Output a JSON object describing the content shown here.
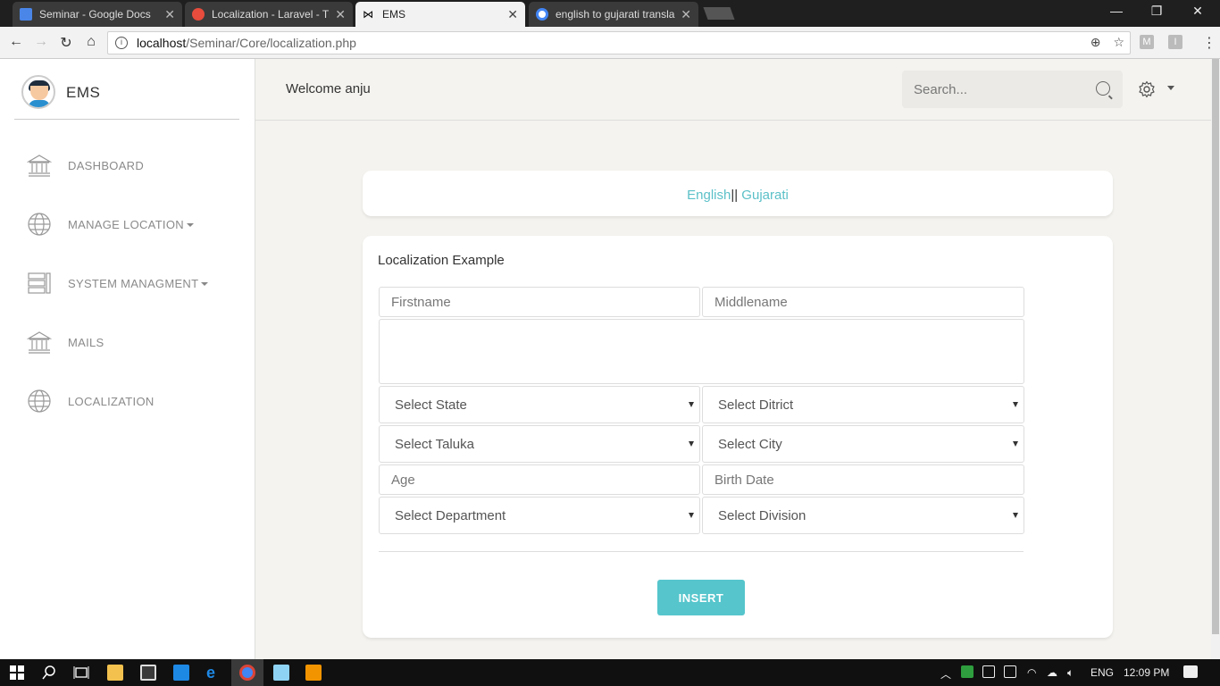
{
  "browser": {
    "tabs": [
      {
        "title": "Seminar - Google Docs",
        "icon": "docs-icon",
        "color": "#4a86e8"
      },
      {
        "title": "Localization - Laravel - Th",
        "icon": "laravel-icon",
        "color": "#e74c3c"
      },
      {
        "title": "EMS",
        "icon": "bow-tie-icon",
        "color": "#000000"
      },
      {
        "title": "english to gujarati transla",
        "icon": "google-icon",
        "color": "#4285f4"
      }
    ],
    "url_host": "localhost",
    "url_path": "/Seminar/Core/localization.php",
    "extensions": [
      "M",
      "I"
    ]
  },
  "app": {
    "brand": "EMS",
    "nav": [
      {
        "label": "DASHBOARD",
        "icon": "bank-icon",
        "dropdown": false
      },
      {
        "label": "MANAGE LOCATION",
        "icon": "globe-icon",
        "dropdown": true
      },
      {
        "label": "SYSTEM MANAGMENT",
        "icon": "list-icon",
        "dropdown": true
      },
      {
        "label": "MAILS",
        "icon": "bank-icon",
        "dropdown": false
      },
      {
        "label": "LOCALIZATION",
        "icon": "globe-icon",
        "dropdown": false
      }
    ],
    "welcome": "Welcome anju",
    "search_placeholder": "Search...",
    "lang": {
      "english": "English",
      "separator": "||",
      "gujarati": " Gujarati"
    },
    "form": {
      "title": "Localization Example",
      "firstname_placeholder": "Firstname",
      "middlename_placeholder": "Middlename",
      "address_value": "",
      "state": "Select State",
      "district": "Select Ditrict",
      "taluka": "Select Taluka",
      "city": "Select City",
      "age_placeholder": "Age",
      "birth_placeholder": "Birth Date",
      "department": "Select Department",
      "division": "Select Division",
      "submit": "INSERT"
    },
    "accent_color": "#56c5cc"
  },
  "taskbar": {
    "language": "ENG",
    "time": "12:09 PM"
  }
}
